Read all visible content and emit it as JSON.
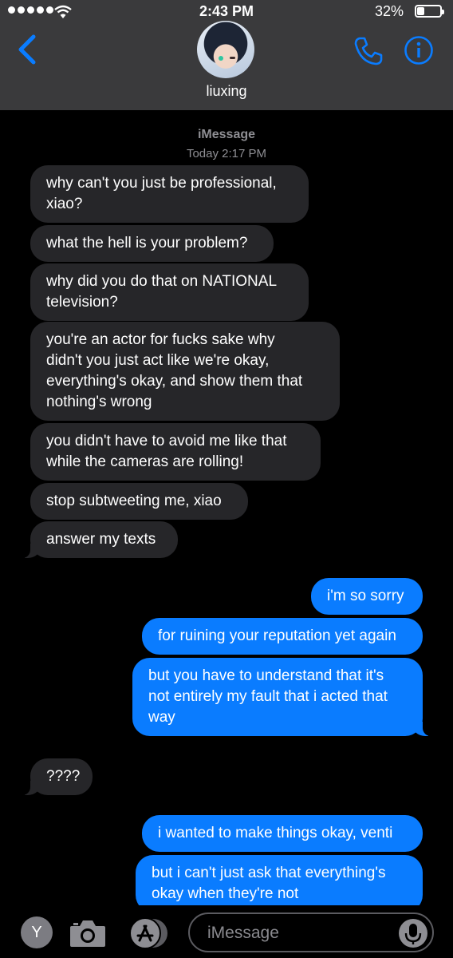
{
  "status_bar": {
    "time": "2:43 PM",
    "battery": "32%",
    "battery_level": 0.32
  },
  "header": {
    "contact_name": "liuxing",
    "back_icon": "chevron-left-icon",
    "call_icon": "phone-icon",
    "details_icon": "info-icon"
  },
  "conversation": {
    "service": "iMessage",
    "timestamp": "Today 2:17 PM",
    "messages": [
      {
        "direction": "incoming",
        "lines": [
          "why can't you just be professional,",
          "xiao?"
        ]
      },
      {
        "direction": "incoming",
        "lines": [
          "what the hell is your problem?"
        ]
      },
      {
        "direction": "incoming",
        "lines": [
          "why did you do that on NATIONAL",
          "television?"
        ]
      },
      {
        "direction": "incoming",
        "lines": [
          "you're an actor for fucks sake why",
          "didn't you just act like we're okay,",
          "everything's okay, and show them that",
          "nothing's wrong"
        ]
      },
      {
        "direction": "incoming",
        "lines": [
          "you didn't have to avoid me like that",
          "while the cameras are rolling!"
        ]
      },
      {
        "direction": "incoming",
        "lines": [
          "stop subtweeting me, xiao"
        ]
      },
      {
        "direction": "incoming",
        "lines": [
          "answer my texts"
        ]
      },
      {
        "direction": "outgoing",
        "lines": [
          "i'm so sorry"
        ]
      },
      {
        "direction": "outgoing",
        "lines": [
          "for ruining your reputation yet again"
        ]
      },
      {
        "direction": "outgoing",
        "lines": [
          "but you have to understand that it's",
          "not entirely my fault that i acted that",
          "way"
        ]
      },
      {
        "direction": "incoming",
        "lines": [
          "????"
        ]
      },
      {
        "direction": "outgoing",
        "lines": [
          "i wanted to make things okay, venti"
        ]
      },
      {
        "direction": "outgoing",
        "lines": [
          "but i can't just ask that everything's",
          "okay when they're not"
        ]
      }
    ]
  },
  "composer": {
    "apps_button_label": "Y",
    "placeholder": "iMessage",
    "camera_icon": "camera-icon",
    "app_store_icon": "app-store-icon",
    "mic_icon": "microphone-icon"
  },
  "colors": {
    "incoming_bubble": "#262629",
    "outgoing_bubble": "#0a7cff",
    "accent": "#0a7cff",
    "header_bg": "#3a3a3c"
  }
}
